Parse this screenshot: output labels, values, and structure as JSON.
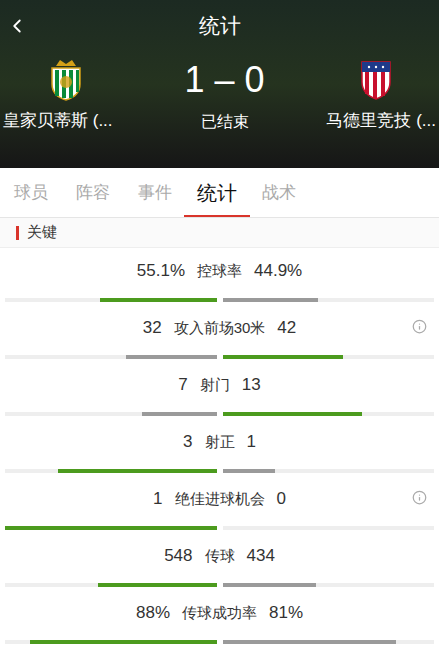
{
  "header": {
    "back": "<",
    "title": "统计"
  },
  "match": {
    "home_team": "皇家贝蒂斯 (...",
    "away_team": "马德里竞技 (...",
    "score": "1 – 0",
    "status": "已结束"
  },
  "tabs": [
    {
      "label": "球员",
      "selected": false
    },
    {
      "label": "阵容",
      "selected": false
    },
    {
      "label": "事件",
      "selected": false
    },
    {
      "label": "统计",
      "selected": true
    },
    {
      "label": "战术",
      "selected": false
    }
  ],
  "section": {
    "title": "关键"
  },
  "stats": [
    {
      "label": "控球率",
      "home": "55.1%",
      "away": "44.9%",
      "home_level": 0.55,
      "away_level": 0.45,
      "home_leads": true,
      "away_leads": false,
      "info": false
    },
    {
      "label": "攻入前场30米",
      "home": "32",
      "away": "42",
      "home_level": 0.43,
      "away_level": 0.57,
      "home_leads": false,
      "away_leads": true,
      "info": true
    },
    {
      "label": "射门",
      "home": "7",
      "away": "13",
      "home_level": 0.35,
      "away_level": 0.66,
      "home_leads": false,
      "away_leads": true,
      "info": false
    },
    {
      "label": "射正",
      "home": "3",
      "away": "1",
      "home_level": 0.75,
      "away_level": 0.25,
      "home_leads": true,
      "away_leads": false,
      "info": false
    },
    {
      "label": "绝佳进球机会",
      "home": "1",
      "away": "0",
      "home_level": 1.0,
      "away_level": 0.0,
      "home_leads": true,
      "away_leads": false,
      "info": true
    },
    {
      "label": "传球",
      "home": "548",
      "away": "434",
      "home_level": 0.56,
      "away_level": 0.44,
      "home_leads": true,
      "away_leads": false,
      "info": false
    },
    {
      "label": "传球成功率",
      "home": "88%",
      "away": "81%",
      "home_leads": true,
      "away_leads": false,
      "home_level": 0.88,
      "away_level": 0.82,
      "info": false
    }
  ]
}
